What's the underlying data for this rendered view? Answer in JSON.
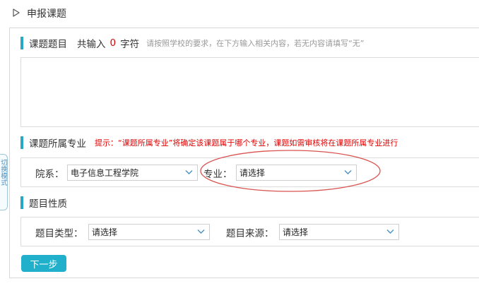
{
  "header": {
    "title": "申报课题"
  },
  "sections": {
    "topic": {
      "title": "课题题目",
      "count_label": "共输入",
      "count_value": "0",
      "count_unit": "字符",
      "hint": "请按照学校的要求，在下方输入相关内容，若无内容请填写“无”",
      "textarea_value": ""
    },
    "major": {
      "title": "课题所属专业",
      "hint": "提示：“课题所属专业”将确定该课题属于哪个专业，课题如需审核将在课题所属专业进行",
      "department_label": "院系：",
      "department_value": "电子信息工程学院",
      "major_label": "专业：",
      "major_value": "请选择"
    },
    "nature": {
      "title": "题目性质",
      "type_label": "题目类型：",
      "type_value": "请选择",
      "source_label": "题目来源：",
      "source_value": "请选择"
    }
  },
  "buttons": {
    "next": "下一步"
  },
  "side_tab": {
    "label": "切换模式"
  },
  "colors": {
    "accent": "#29a8c6",
    "button": "#21b0cb",
    "hint_red": "#e10000",
    "annotation": "#d9534f"
  }
}
